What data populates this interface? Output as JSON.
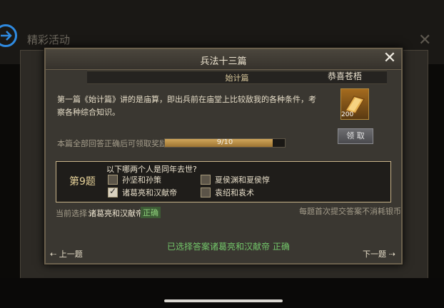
{
  "background": {
    "title": "精彩活动",
    "back_icon": "back-arrow-icon",
    "close_symbol": "✕"
  },
  "dialog": {
    "title": "兵法十三篇",
    "close_symbol": "✕",
    "chapter_title": "始计篇",
    "sub_title": "恭喜苍梧",
    "description": "第一篇《始计篇》讲的是庙算，即出兵前在庙堂上比较敌我的各种条件，考察各种综合知识。",
    "reward": {
      "icon": "gold-ingot-icon",
      "count": "200",
      "claim_label": "领 取"
    },
    "progress": {
      "label": "本篇全部回答正确后可领取奖励：",
      "text": "9/10",
      "fraction": 0.9
    },
    "question": {
      "number": "第9题",
      "text": "以下哪两个人是同年去世?",
      "options": [
        {
          "label": "孙坚和孙策",
          "checked": false
        },
        {
          "label": "夏侯渊和夏侯惇",
          "checked": false
        },
        {
          "label": "诸葛亮和汉献帝",
          "checked": true
        },
        {
          "label": "袁绍和袁术",
          "checked": false
        }
      ]
    },
    "current": {
      "label": "当前选择：",
      "value": "诸葛亮和汉献帝",
      "status": "正确"
    },
    "note": "每题首次提交答案不消耗银币",
    "result": "已选择答案诸葛亮和汉献帝 正确",
    "prev_label": "上一题",
    "next_label": "下一题"
  },
  "colors": {
    "accent_gold": "#d1a75b",
    "correct_green": "#73c76a",
    "back_button_blue": "#2f8ae0"
  }
}
